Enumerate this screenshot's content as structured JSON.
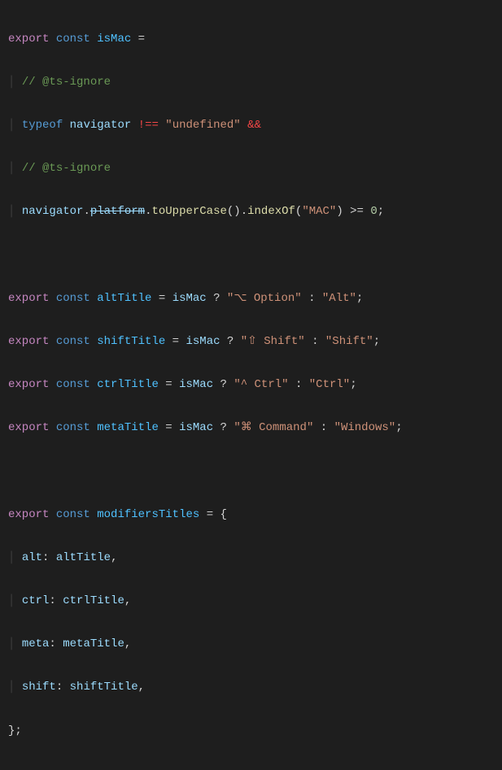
{
  "line1": {
    "kw_export": "export",
    "kw_const": "const",
    "var": "isMac",
    "eq": "="
  },
  "line2": {
    "bar": "│",
    "comment": "// @ts-ignore"
  },
  "line3": {
    "bar": "│",
    "kw_typeof": "typeof",
    "nav": "navigator",
    "neq": "!==",
    "str": "\"undefined\"",
    "amp": "&&"
  },
  "line4": {
    "bar": "│",
    "comment": "// @ts-ignore"
  },
  "line5": {
    "bar": "│",
    "nav": "navigator",
    "dot1": ".",
    "platform": "platform",
    "dot2": ".",
    "toUpper": "toUpperCase",
    "par1": "().",
    "indexOf": "indexOf",
    "open": "(",
    "mac": "\"MAC\"",
    "close": ")",
    "gte": ">=",
    "zero": "0",
    "semi": ";"
  },
  "line7": {
    "kw_export": "export",
    "kw_const": "const",
    "var": "altTitle",
    "eq": "=",
    "cond": "isMac",
    "q": "?",
    "s1": "\"⌥ Option\"",
    "colon": ":",
    "s2": "\"Alt\"",
    "semi": ";"
  },
  "line8": {
    "kw_export": "export",
    "kw_const": "const",
    "var": "shiftTitle",
    "eq": "=",
    "cond": "isMac",
    "q": "?",
    "s1": "\"⇧ Shift\"",
    "colon": ":",
    "s2": "\"Shift\"",
    "semi": ";"
  },
  "line9": {
    "kw_export": "export",
    "kw_const": "const",
    "var": "ctrlTitle",
    "eq": "=",
    "cond": "isMac",
    "q": "?",
    "s1": "\"^ Ctrl\"",
    "colon": ":",
    "s2": "\"Ctrl\"",
    "semi": ";"
  },
  "line10": {
    "kw_export": "export",
    "kw_const": "const",
    "var": "metaTitle",
    "eq": "=",
    "cond": "isMac",
    "q": "?",
    "s1": "\"⌘ Command\"",
    "colon": ":",
    "s2": "\"Windows\"",
    "semi": ";"
  },
  "line12": {
    "kw_export": "export",
    "kw_const": "const",
    "var": "modifiersTitles",
    "eq": "=",
    "brace": "{"
  },
  "line13": {
    "bar": "│",
    "key": "alt",
    "colon": ":",
    "val": "altTitle",
    "comma": ","
  },
  "line14": {
    "bar": "│",
    "key": "ctrl",
    "colon": ":",
    "val": "ctrlTitle",
    "comma": ","
  },
  "line15": {
    "bar": "│",
    "key": "meta",
    "colon": ":",
    "val": "metaTitle",
    "comma": ","
  },
  "line16": {
    "bar": "│",
    "key": "shift",
    "colon": ":",
    "val": "shiftTitle",
    "comma": ","
  },
  "line17": {
    "brace": "};"
  }
}
